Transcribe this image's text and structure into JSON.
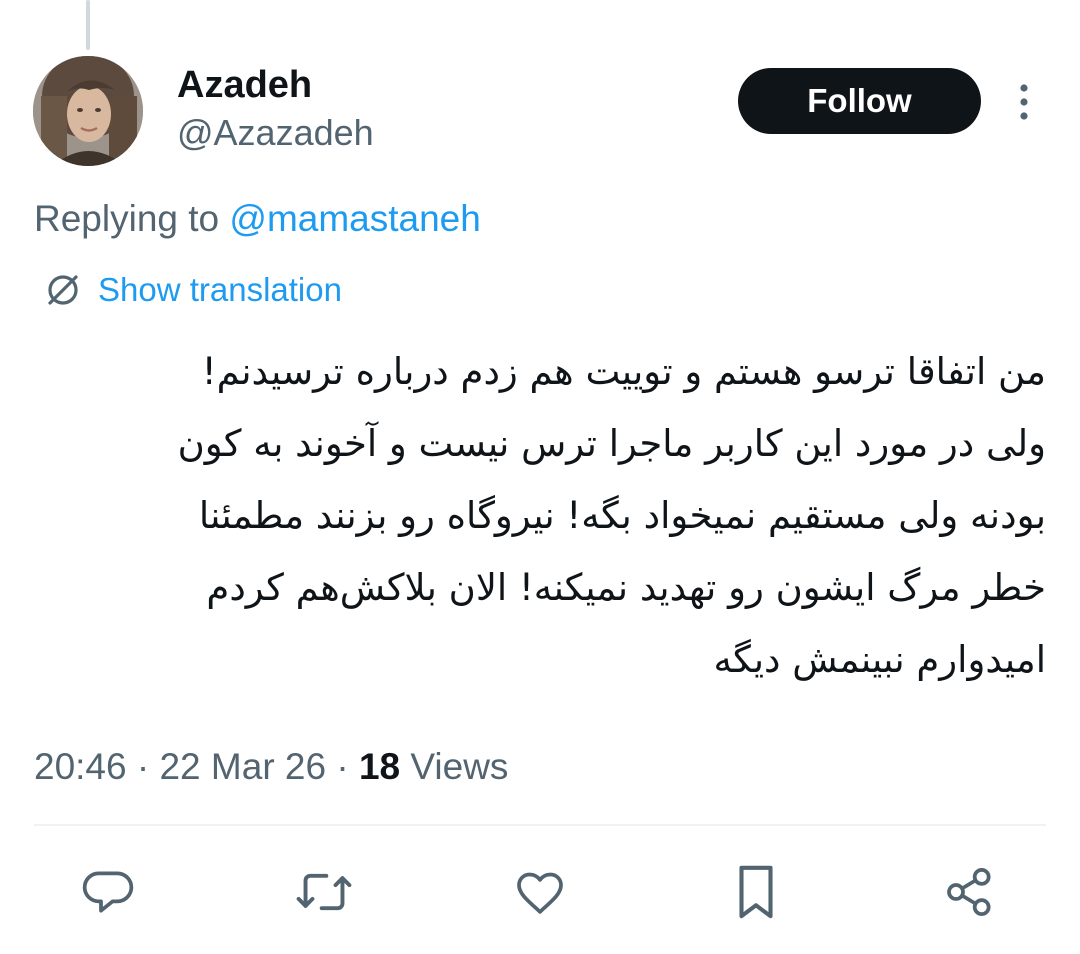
{
  "author": {
    "display_name": "Azadeh",
    "handle": "@Azazadeh"
  },
  "header": {
    "follow_label": "Follow",
    "more_icon": "more-vertical-icon"
  },
  "reply": {
    "prefix": "Replying to ",
    "mention": "@mamastaneh"
  },
  "translation": {
    "label": "Show translation",
    "icon": "globe-translate-icon"
  },
  "tweet": {
    "lines": [
      "من اتفاقا ترسو هستم و توییت هم زدم درباره ترسیدنم!",
      "ولی در مورد این کاربر ماجرا ترس نیست و آخوند به کون",
      "بودنه ولی مستقیم نمیخواد بگه! نیروگاه رو بزنند مطمئنا",
      "خطر مرگ ایشون رو تهدید نمیکنه! الان بلاکش‌هم کردم",
      "امیدوارم نبینمش دیگه"
    ]
  },
  "meta": {
    "time": "20:46",
    "separator": " · ",
    "date": "22 Mar 26",
    "views_count": "18",
    "views_label": " Views"
  },
  "actions": [
    "reply-icon",
    "retweet-icon",
    "like-icon",
    "bookmark-icon",
    "share-icon"
  ],
  "colors": {
    "text": "#0f1419",
    "secondary": "#536471",
    "link": "#1d9bf0",
    "follow_bg": "#0f1419",
    "icon": "#536471"
  }
}
